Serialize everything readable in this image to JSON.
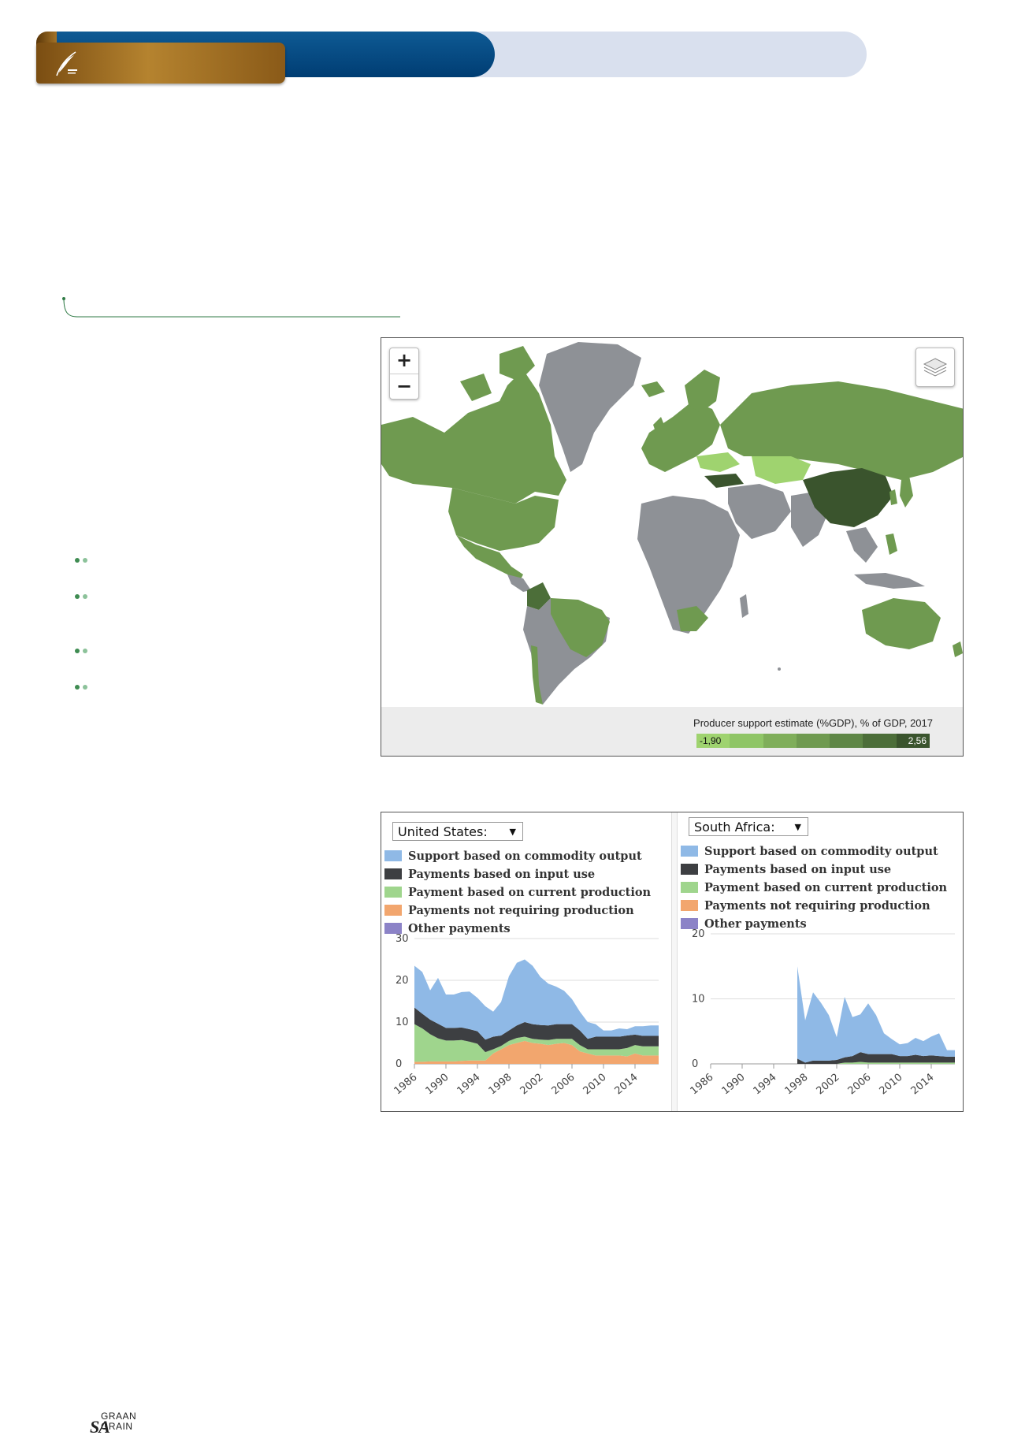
{
  "footer": {
    "logo_sa": "SA",
    "logo_graan": "GRAAN",
    "logo_grain": "GRAIN"
  },
  "map": {
    "zoom_in": "+",
    "zoom_out": "−",
    "legend_title": "Producer support estimate (%GDP), % of GDP, 2017",
    "legend_min": "-1,90",
    "legend_max": "2,56",
    "colors": {
      "no_data": "#8e9196",
      "scale": [
        "#9fd36f",
        "#8fc566",
        "#7fae5a",
        "#6f9a50",
        "#5e8646",
        "#4c6e39",
        "#3a542d"
      ],
      "ocean": "#ffffff"
    }
  },
  "charts": {
    "series_colors": {
      "commodity_output": "#8fb9e6",
      "input_use": "#3d3f42",
      "current_production": "#9fd58d",
      "not_requiring_production": "#f2a66e",
      "other": "#8c83c7"
    },
    "chart_data": [
      {
        "type": "area",
        "country": "United States:",
        "legend": [
          "Support based on commodity output",
          "Payments based on input use",
          "Payment based on current production",
          "Payments not requiring production",
          "Other payments"
        ],
        "x": [
          1986,
          1987,
          1988,
          1989,
          1990,
          1991,
          1992,
          1993,
          1994,
          1995,
          1996,
          1997,
          1998,
          1999,
          2000,
          2001,
          2002,
          2003,
          2004,
          2005,
          2006,
          2007,
          2008,
          2009,
          2010,
          2011,
          2012,
          2013,
          2014,
          2015,
          2016,
          2017
        ],
        "x_ticks": [
          "1986",
          "1990",
          "1994",
          "1998",
          "2002",
          "2006",
          "2010",
          "2014"
        ],
        "y_ticks": [
          "0",
          "10",
          "20",
          "30"
        ],
        "ylim": [
          0,
          30
        ],
        "series": [
          {
            "name": "Payments not requiring production",
            "values": [
              0.5,
              0.5,
              0.6,
              0.6,
              0.6,
              0.6,
              0.7,
              0.8,
              0.8,
              0.8,
              2.5,
              3.5,
              4.5,
              5.0,
              5.5,
              5.0,
              4.8,
              4.5,
              4.8,
              5.0,
              4.5,
              3.0,
              2.5,
              2.0,
              2.0,
              2.0,
              2.0,
              1.8,
              2.5,
              2.0,
              2.0,
              2.0
            ]
          },
          {
            "name": "Payment based on current production",
            "values": [
              9.0,
              8.0,
              6.5,
              5.5,
              5.0,
              5.0,
              5.0,
              4.5,
              4.0,
              2.0,
              1.0,
              0.8,
              1.0,
              1.2,
              1.0,
              1.0,
              1.0,
              1.2,
              1.2,
              1.0,
              1.5,
              1.5,
              1.0,
              1.5,
              1.5,
              1.5,
              1.5,
              2.0,
              2.0,
              2.2,
              2.2,
              2.2
            ]
          },
          {
            "name": "Payments based on input use",
            "values": [
              4.0,
              3.5,
              3.5,
              3.5,
              3.0,
              3.0,
              3.0,
              3.0,
              3.0,
              3.0,
              3.0,
              2.5,
              2.5,
              3.0,
              3.5,
              3.5,
              3.5,
              3.5,
              3.5,
              3.5,
              3.5,
              3.5,
              2.5,
              3.0,
              3.0,
              3.0,
              3.0,
              3.0,
              2.5,
              2.5,
              2.5,
              2.5
            ]
          },
          {
            "name": "Support based on commodity output",
            "values": [
              10.0,
              10.0,
              7.0,
              11.0,
              8.0,
              8.0,
              8.5,
              9.0,
              8.0,
              8.0,
              6.0,
              8.0,
              13.0,
              15.0,
              15.0,
              14.0,
              11.5,
              10.0,
              9.0,
              8.0,
              6.0,
              4.5,
              4.0,
              3.0,
              1.5,
              1.5,
              2.0,
              1.5,
              2.0,
              2.3,
              2.5,
              2.5
            ]
          },
          {
            "name": "Other payments",
            "values": [
              0,
              0,
              0,
              0,
              0,
              0,
              0,
              0,
              0,
              0,
              0,
              0,
              0,
              0,
              0,
              0,
              0,
              0,
              0,
              0,
              0,
              0,
              0,
              0,
              0,
              0,
              0,
              0,
              0,
              0,
              0,
              0
            ]
          }
        ]
      },
      {
        "type": "area",
        "country": "South Africa:",
        "legend": [
          "Support based on commodity output",
          "Payments based on input use",
          "Payment based on current production",
          "Payments not requiring production",
          "Other payments"
        ],
        "x": [
          1986,
          1987,
          1988,
          1989,
          1990,
          1991,
          1992,
          1993,
          1994,
          1995,
          1996,
          1997,
          1998,
          1999,
          2000,
          2001,
          2002,
          2003,
          2004,
          2005,
          2006,
          2007,
          2008,
          2009,
          2010,
          2011,
          2012,
          2013,
          2014,
          2015,
          2016,
          2017
        ],
        "x_ticks": [
          "1986",
          "1990",
          "1994",
          "1998",
          "2002",
          "2006",
          "2010",
          "2014"
        ],
        "y_ticks": [
          "0",
          "10",
          "20"
        ],
        "ylim": [
          0,
          20
        ],
        "series": [
          {
            "name": "Payments not requiring production",
            "values": [
              null,
              null,
              null,
              null,
              null,
              null,
              null,
              null,
              null,
              null,
              null,
              0,
              0,
              0,
              0,
              0,
              0,
              0,
              0,
              0,
              0,
              0,
              0,
              0,
              0,
              0,
              0,
              0,
              0,
              0,
              0,
              0
            ]
          },
          {
            "name": "Payment based on current production",
            "values": [
              null,
              null,
              null,
              null,
              null,
              null,
              null,
              null,
              null,
              null,
              null,
              0,
              0,
              0,
              0,
              0,
              0,
              0.2,
              0.2,
              0.3,
              0.2,
              0.2,
              0.2,
              0.2,
              0.2,
              0.2,
              0.2,
              0.2,
              0.2,
              0.2,
              0.2,
              0.2
            ]
          },
          {
            "name": "Payments based on input use",
            "values": [
              null,
              null,
              null,
              null,
              null,
              null,
              null,
              null,
              null,
              null,
              null,
              0.8,
              0.2,
              0.5,
              0.5,
              0.5,
              0.6,
              0.8,
              1.0,
              1.5,
              1.3,
              1.3,
              1.3,
              1.3,
              1.0,
              1.0,
              1.2,
              1.0,
              1.1,
              1.0,
              0.9,
              0.9
            ]
          },
          {
            "name": "Support based on commodity output",
            "values": [
              null,
              null,
              null,
              null,
              null,
              null,
              null,
              null,
              null,
              null,
              null,
              14.2,
              6.5,
              10.5,
              8.9,
              7.0,
              3.5,
              9.3,
              6.0,
              5.8,
              7.8,
              6.0,
              3.2,
              2.3,
              1.8,
              2.0,
              2.6,
              2.3,
              2.9,
              3.5,
              1.0,
              1.0
            ]
          },
          {
            "name": "Other payments",
            "values": [
              null,
              null,
              null,
              null,
              null,
              null,
              null,
              null,
              null,
              null,
              null,
              0,
              0,
              0,
              0,
              0,
              0,
              0,
              0,
              0,
              0,
              0,
              0,
              0,
              0,
              0,
              0,
              0,
              0,
              0,
              0,
              0
            ]
          }
        ]
      }
    ]
  }
}
